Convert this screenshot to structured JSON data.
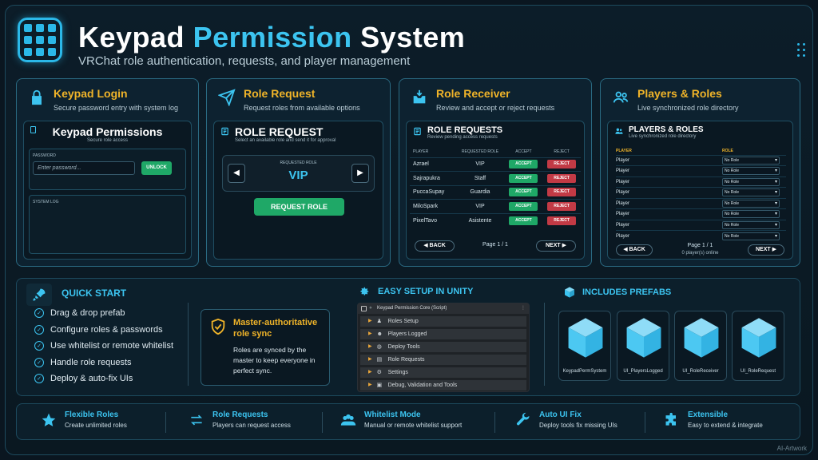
{
  "header": {
    "title_main": "Keypad",
    "title_accent": "Permission",
    "title_end": "System",
    "subtitle": "VRChat role authentication, requests, and player management"
  },
  "colors": {
    "accent": "#3cc4f0",
    "gold": "#f0b429",
    "green": "#1fa867",
    "red": "#c23a45"
  },
  "keypad_login": {
    "title": "Keypad Login",
    "desc": "Secure password entry with system log",
    "inner_title": "Keypad Permissions",
    "inner_sub": "Secure role access",
    "password_label": "PASSWORD",
    "password_placeholder": "Enter password...",
    "unlock_label": "UNLOCK",
    "syslog_label": "SYSTEM LOG",
    "icon": "lock-icon"
  },
  "role_request": {
    "title": "Role Request",
    "desc": "Request roles from available options",
    "inner_title": "ROLE REQUEST",
    "inner_sub": "Select an available role and send it for approval",
    "requested_label": "REQUESTED ROLE",
    "selected_role": "VIP",
    "button_label": "REQUEST ROLE",
    "icon": "paper-plane-icon"
  },
  "role_receiver": {
    "title": "Role Receiver",
    "desc": "Review and accept or reject requests",
    "inner_title": "ROLE REQUESTS",
    "inner_sub": "Review pending access requests",
    "columns": [
      "PLAYER",
      "REQUESTED ROLE",
      "ACCEPT",
      "REJECT"
    ],
    "rows": [
      {
        "player": "Azrael",
        "role": "VIP"
      },
      {
        "player": "Sajrapukra",
        "role": "Staff"
      },
      {
        "player": "PuccaSupay",
        "role": "Guardia"
      },
      {
        "player": "MiloSpark",
        "role": "VIP"
      },
      {
        "player": "PixelTavo",
        "role": "Asistente"
      }
    ],
    "accept_label": "ACCEPT",
    "reject_label": "REJECT",
    "back_label": "BACK",
    "next_label": "NEXT",
    "page": "Page 1 / 1",
    "icon": "inbox-icon"
  },
  "players_roles": {
    "title": "Players & Roles",
    "desc": "Live synchronized role directory",
    "inner_title": "PLAYERS & ROLES",
    "inner_sub": "Live synchronized role directory",
    "columns": [
      "PLAYER",
      "ROLE"
    ],
    "rows": [
      {
        "player": "Player",
        "role": "No Role"
      },
      {
        "player": "Player",
        "role": "No Role"
      },
      {
        "player": "Player",
        "role": "No Role"
      },
      {
        "player": "Player",
        "role": "No Role"
      },
      {
        "player": "Player",
        "role": "No Role"
      },
      {
        "player": "Player",
        "role": "No Role"
      },
      {
        "player": "Player",
        "role": "No Role"
      },
      {
        "player": "Player",
        "role": "No Role"
      }
    ],
    "page": "Page 1 / 1",
    "online": "0 player(s) online",
    "back_label": "BACK",
    "next_label": "NEXT",
    "icon": "users-icon"
  },
  "quick_start": {
    "title": "QUICK START",
    "items": [
      "Drag & drop prefab",
      "Configure roles & passwords",
      "Use whitelist or remote whitelist",
      "Handle role requests",
      "Deploy & auto-fix UIs"
    ],
    "sync_title": "Master-authoritative role sync",
    "sync_desc": "Roles are synced by the master to keep everyone in perfect sync."
  },
  "easy_setup": {
    "title": "EASY SETUP IN UNITY",
    "script_title": "Keypad Permission Core (Script)",
    "rows": [
      {
        "label": "Roles Setup",
        "icon": "roles-icon"
      },
      {
        "label": "Players Logged",
        "icon": "players-icon"
      },
      {
        "label": "Deploy Tools",
        "icon": "globe-icon"
      },
      {
        "label": "Role Requests",
        "icon": "request-icon"
      },
      {
        "label": "Settings",
        "icon": "settings-icon"
      },
      {
        "label": "Debug, Validation and Tools",
        "icon": "debug-icon"
      }
    ]
  },
  "prefabs": {
    "title": "INCLUDES PREFABS",
    "items": [
      "KeypadPermSystem",
      "UI_PlayersLogged",
      "UI_RoleReceiver",
      "UI_RoleRequest"
    ]
  },
  "features": [
    {
      "title": "Flexible Roles",
      "desc": "Create unlimited roles",
      "icon": "star-icon"
    },
    {
      "title": "Role Requests",
      "desc": "Players can request access",
      "icon": "swap-icon"
    },
    {
      "title": "Whitelist Mode",
      "desc": "Manual or remote whitelist support",
      "icon": "group-icon"
    },
    {
      "title": "Auto UI Fix",
      "desc": "Deploy tools fix missing UIs",
      "icon": "wrench-icon"
    },
    {
      "title": "Extensible",
      "desc": "Easy to extend & integrate",
      "icon": "puzzle-icon"
    }
  ],
  "watermark": "AI-Artwork"
}
